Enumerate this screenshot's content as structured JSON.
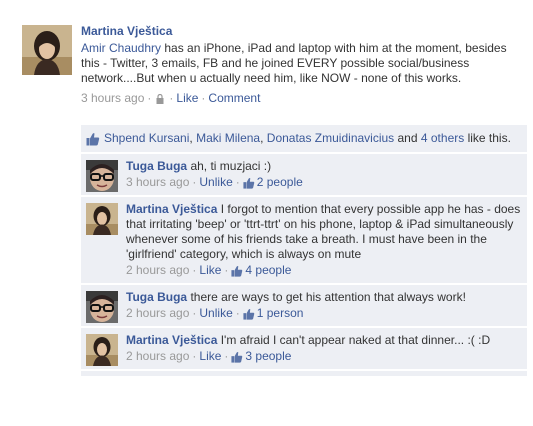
{
  "post": {
    "author": "Martina Vještica",
    "text_link": "Amir Chaudhry",
    "text_rest": " has an iPhone, iPad and laptop with him at the moment, besides this - Twitter, 3 emails, FB and he joined EVERY possible social/business network....But when u actually need him, like NOW - none of this works.",
    "time": "3 hours ago",
    "sep": "·",
    "like_label": "Like",
    "comment_label": "Comment",
    "privacy_icon": "lock-icon"
  },
  "likes": {
    "icon": "thumbs-up-icon",
    "names": [
      "Shpend Kursani",
      "Maki Milena",
      "Donatas Zmuidinavicius"
    ],
    "comma": ", ",
    "and": " and ",
    "others_label": "4 others",
    "suffix": " like this."
  },
  "comments": [
    {
      "author": "Tuga Buga",
      "text": " ah, ti muzjaci :)",
      "time": "3 hours ago",
      "action": "Unlike",
      "likes_label": "2 people"
    },
    {
      "author": "Martina Vještica",
      "text": " I forgot to mention that every possible app he has - does that irritating 'beep' or 'ttrt-ttrt' on his phone, laptop & iPad simultaneously whenever some of his friends take a breath. I must have been in the 'girlfriend' category, which is always on mute",
      "time": "2 hours ago",
      "action": "Like",
      "likes_label": "4 people"
    },
    {
      "author": "Tuga Buga",
      "text": " there are ways to get his attention that always work!",
      "time": "2 hours ago",
      "action": "Unlike",
      "likes_label": "1 person"
    },
    {
      "author": "Martina Vještica",
      "text": " I'm afraid I can't appear naked at that dinner... :( :D",
      "time": "2 hours ago",
      "action": "Like",
      "likes_label": "3 people"
    }
  ],
  "colors": {
    "link": "#3b5998",
    "ufi_background": "#edeff4",
    "meta_text": "#999999"
  }
}
